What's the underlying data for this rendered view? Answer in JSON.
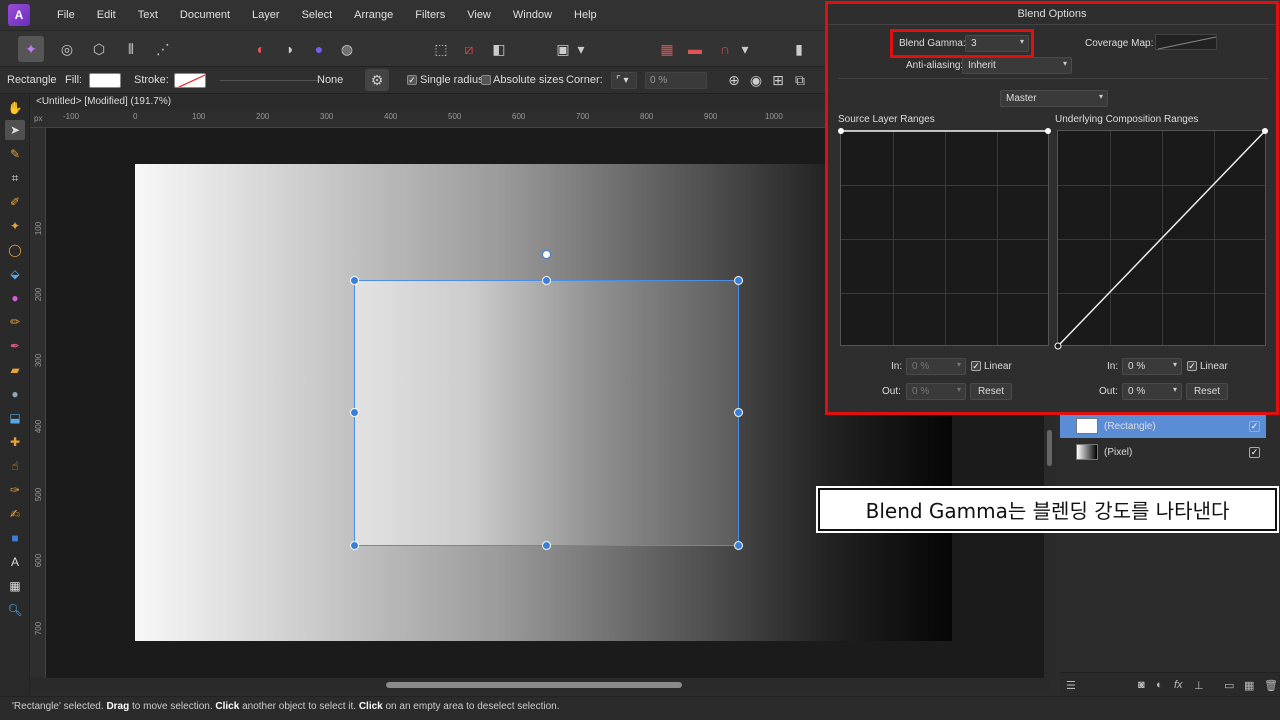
{
  "menubar": {
    "items": [
      "File",
      "Edit",
      "Text",
      "Document",
      "Layer",
      "Select",
      "Arrange",
      "Filters",
      "View",
      "Window",
      "Help"
    ]
  },
  "contextbar": {
    "tool_name": "Rectangle",
    "fill_label": "Fill:",
    "stroke_label": "Stroke:",
    "stroke_none": "None",
    "single_radius": "Single radius",
    "absolute_sizes": "Absolute sizes",
    "corner_label": "Corner:",
    "corner_value": "0 %"
  },
  "document": {
    "title": "<Untitled> [Modified] (191.7%)"
  },
  "rulers": {
    "unit": "px",
    "h_ticks": [
      "-100",
      "0",
      "100",
      "200",
      "300",
      "400",
      "500",
      "600",
      "700",
      "800",
      "900",
      "1000"
    ],
    "v_ticks": [
      "100",
      "200",
      "300",
      "400",
      "500",
      "600",
      "700"
    ]
  },
  "blend_options": {
    "title": "Blend Options",
    "blend_gamma_label": "Blend Gamma:",
    "blend_gamma_value": "3",
    "coverage_map_label": "Coverage Map:",
    "anti_aliasing_label": "Anti-aliasing:",
    "anti_aliasing_value": "Inherit",
    "channel_value": "Master",
    "source_ranges_label": "Source Layer Ranges",
    "underlying_ranges_label": "Underlying Composition Ranges",
    "source_in_label": "In:",
    "source_in_value": "0 %",
    "source_out_label": "Out:",
    "source_out_value": "0 %",
    "source_linear": "Linear",
    "source_reset": "Reset",
    "under_in_label": "In:",
    "under_in_value": "0 %",
    "under_out_label": "Out:",
    "under_out_value": "0 %",
    "under_linear": "Linear",
    "under_reset": "Reset"
  },
  "layers": {
    "items": [
      {
        "name": "(Rectangle)",
        "selected": true
      },
      {
        "name": "(Pixel)",
        "selected": false
      }
    ]
  },
  "annotation": {
    "text": "Blend Gamma는 블렌딩 강도를 나타낸다"
  },
  "status": {
    "part1": "'Rectangle' selected. ",
    "drag": "Drag",
    "part2": " to move selection. ",
    "click1": "Click",
    "part3": " another object to select it. ",
    "click2": "Click",
    "part4": " on an empty area to deselect selection."
  },
  "colors": {
    "accent_red": "#e01010",
    "selection_blue": "#3b7fd9",
    "layer_selected": "#5b8dd6"
  }
}
